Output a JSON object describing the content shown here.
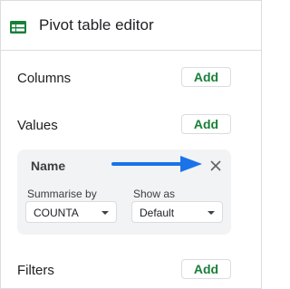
{
  "header": {
    "icon": "pivot-table-icon",
    "title": "Pivot table editor",
    "accent_color": "#188038"
  },
  "sections": {
    "columns": {
      "label": "Columns",
      "button": "Add"
    },
    "values": {
      "label": "Values",
      "button": "Add"
    },
    "filters": {
      "label": "Filters",
      "button": "Add"
    }
  },
  "value_card": {
    "name": "Name",
    "close_icon": "close-icon",
    "summarise": {
      "label": "Summarise by",
      "selected": "COUNTA"
    },
    "show_as": {
      "label": "Show as",
      "selected": "Default"
    }
  },
  "annotation": {
    "arrow_color": "#1a73e8"
  }
}
